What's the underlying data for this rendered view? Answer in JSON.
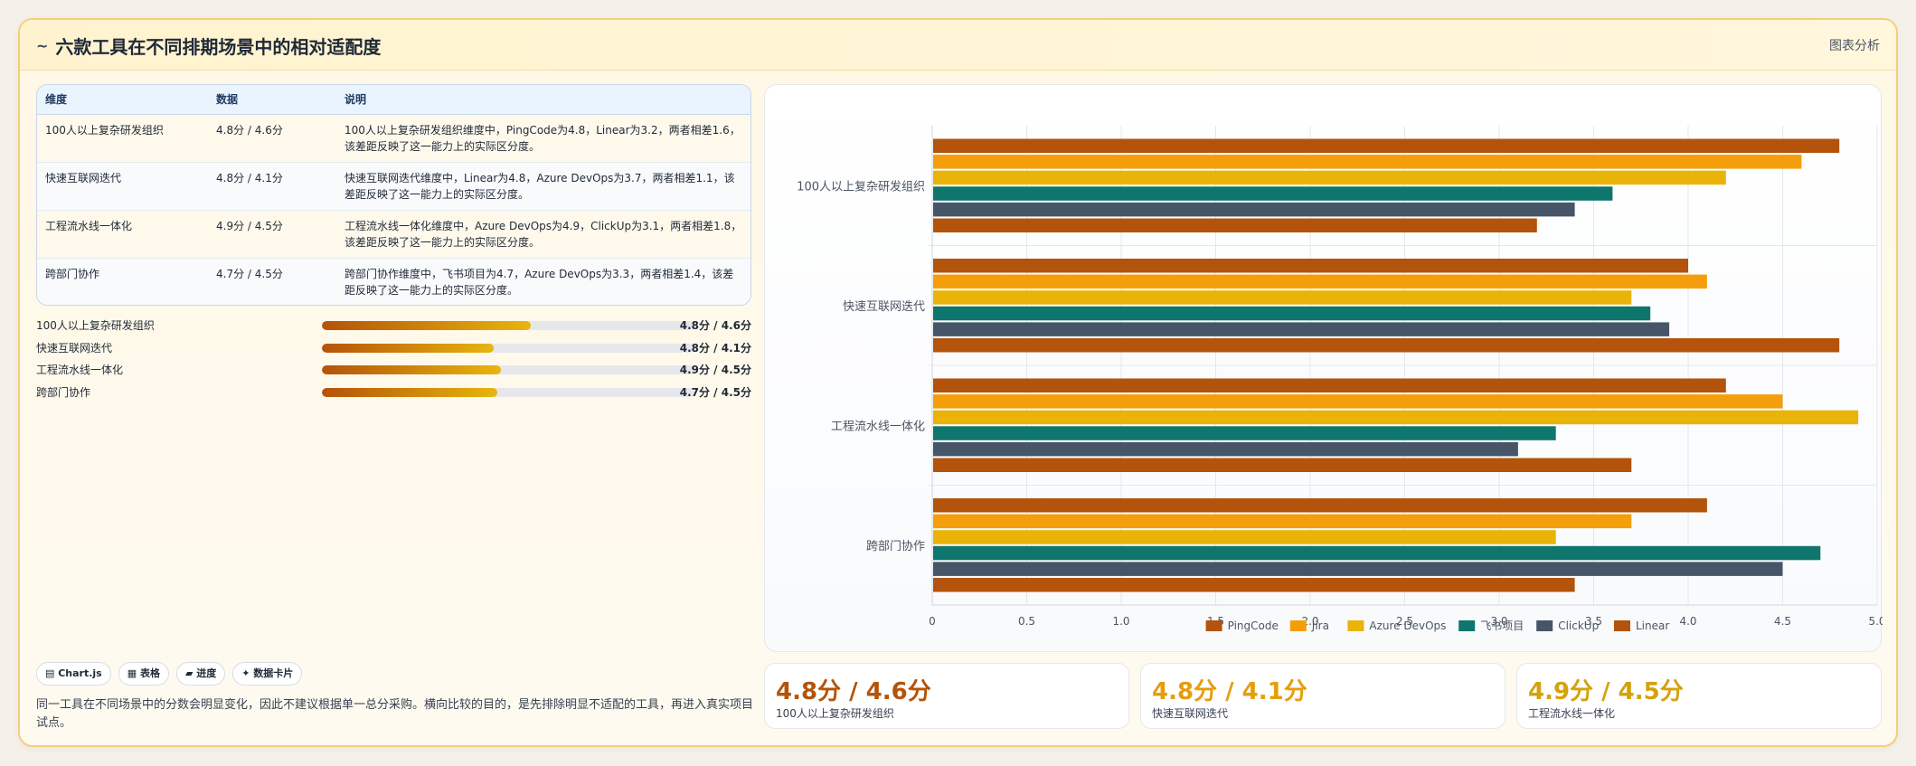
{
  "header": {
    "title": "六款工具在不同排期场景中的相对适配度",
    "title_icon": "~",
    "tag": "图表分析"
  },
  "table": {
    "columns": [
      "维度",
      "数据",
      "说明"
    ],
    "rows": [
      {
        "dim": "100人以上复杂研发组织",
        "data": "4.8分 / 4.6分",
        "desc": "100人以上复杂研发组织维度中，PingCode为4.8，Linear为3.2，两者相差1.6，该差距反映了这一能力上的实际区分度。"
      },
      {
        "dim": "快速互联网迭代",
        "data": "4.8分 / 4.1分",
        "desc": "快速互联网迭代维度中，Linear为4.8，Azure DevOps为3.7，两者相差1.1，该差距反映了这一能力上的实际区分度。"
      },
      {
        "dim": "工程流水线一体化",
        "data": "4.9分 / 4.5分",
        "desc": "工程流水线一体化维度中，Azure DevOps为4.9，ClickUp为3.1，两者相差1.8，该差距反映了这一能力上的实际区分度。"
      },
      {
        "dim": "跨部门协作",
        "data": "4.7分 / 4.5分",
        "desc": "跨部门协作维度中，飞书项目为4.7，Azure DevOps为3.3，两者相差1.4，该差距反映了这一能力上的实际区分度。"
      }
    ]
  },
  "progress": [
    {
      "label": "100人以上复杂研发组织",
      "value": "4.8分 / 4.6分",
      "fill": 0.56
    },
    {
      "label": "快速互联网迭代",
      "value": "4.8分 / 4.1分",
      "fill": 0.46
    },
    {
      "label": "工程流水线一体化",
      "value": "4.9分 / 4.5分",
      "fill": 0.48
    },
    {
      "label": "跨部门协作",
      "value": "4.7分 / 4.5分",
      "fill": 0.47
    }
  ],
  "chips": [
    "▤ Chart.js",
    "▦ 表格",
    "▰ 进度",
    "✦ 数据卡片"
  ],
  "note": "同一工具在不同场景中的分数会明显变化，因此不建议根据单一总分采购。横向比较的目的，是先排除明显不适配的工具，再进入真实项目试点。",
  "stats": [
    {
      "value": "4.8分 / 4.6分",
      "label": "100人以上复杂研发组织",
      "color": "#b45309"
    },
    {
      "value": "4.8分 / 4.1分",
      "label": "快速互联网迭代",
      "color": "#e59e0b"
    },
    {
      "value": "4.9分 / 4.5分",
      "label": "工程流水线一体化",
      "color": "#d4a20a"
    }
  ],
  "chart_data": {
    "type": "bar",
    "orientation": "horizontal",
    "categories": [
      "100人以上复杂研发组织",
      "快速互联网迭代",
      "工程流水线一体化",
      "跨部门协作"
    ],
    "series": [
      {
        "name": "PingCode",
        "color": "#b4530b",
        "values": [
          4.8,
          4.0,
          4.2,
          4.1
        ]
      },
      {
        "name": "Jira",
        "color": "#f59e0b",
        "values": [
          4.6,
          4.1,
          4.5,
          3.7
        ]
      },
      {
        "name": "Azure DevOps",
        "color": "#eab308",
        "values": [
          4.2,
          3.7,
          4.9,
          3.3
        ]
      },
      {
        "name": "飞书项目",
        "color": "#0f766e",
        "values": [
          3.6,
          3.8,
          3.3,
          4.7
        ]
      },
      {
        "name": "ClickUp",
        "color": "#475569",
        "values": [
          3.4,
          3.9,
          3.1,
          4.5
        ]
      },
      {
        "name": "Linear",
        "color": "#b4530b",
        "values": [
          3.2,
          4.8,
          3.7,
          3.4
        ]
      }
    ],
    "xlim": [
      0,
      5
    ],
    "xticks": [
      "0",
      "0.5",
      "1.0",
      "1.5",
      "2.0",
      "2.5",
      "3.0",
      "3.5",
      "4.0",
      "4.5",
      "5.0"
    ],
    "grid": true,
    "legend": "bottom"
  }
}
